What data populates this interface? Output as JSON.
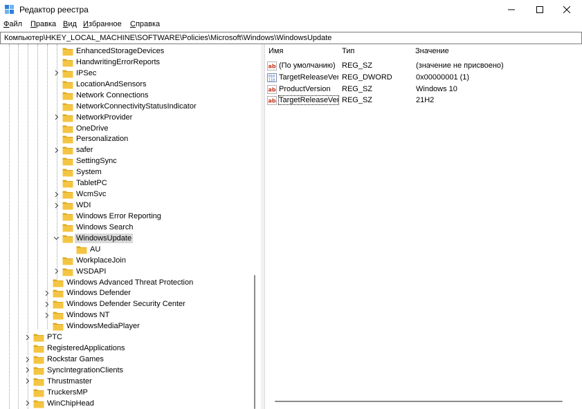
{
  "window": {
    "title": "Редактор реестра",
    "controls": {
      "minimize": "minimize",
      "maximize": "maximize",
      "close": "close"
    }
  },
  "menu": [
    {
      "first": "Ф",
      "rest": "айл"
    },
    {
      "first": "П",
      "rest": "равка"
    },
    {
      "first": "В",
      "rest": "ид"
    },
    {
      "first": "И",
      "rest": "збранное"
    },
    {
      "first": "С",
      "rest": "правка"
    }
  ],
  "address": "Компьютер\\HKEY_LOCAL_MACHINE\\SOFTWARE\\Policies\\Microsoft\\Windows\\WindowsUpdate",
  "tree": [
    {
      "label": "EnhancedStorageDevices",
      "expander": "none",
      "level": 3
    },
    {
      "label": "HandwritingErrorReports",
      "expander": "none",
      "level": 3
    },
    {
      "label": "IPSec",
      "expander": "collapsed",
      "level": 3
    },
    {
      "label": "LocationAndSensors",
      "expander": "none",
      "level": 3
    },
    {
      "label": "Network Connections",
      "expander": "none",
      "level": 3
    },
    {
      "label": "NetworkConnectivityStatusIndicator",
      "expander": "none",
      "level": 3
    },
    {
      "label": "NetworkProvider",
      "expander": "collapsed",
      "level": 3
    },
    {
      "label": "OneDrive",
      "expander": "none",
      "level": 3
    },
    {
      "label": "Personalization",
      "expander": "none",
      "level": 3
    },
    {
      "label": "safer",
      "expander": "collapsed",
      "level": 3
    },
    {
      "label": "SettingSync",
      "expander": "none",
      "level": 3
    },
    {
      "label": "System",
      "expander": "none",
      "level": 3
    },
    {
      "label": "TabletPC",
      "expander": "none",
      "level": 3
    },
    {
      "label": "WcmSvc",
      "expander": "collapsed",
      "level": 3
    },
    {
      "label": "WDI",
      "expander": "collapsed",
      "level": 3
    },
    {
      "label": "Windows Error Reporting",
      "expander": "none",
      "level": 3
    },
    {
      "label": "Windows Search",
      "expander": "none",
      "level": 3
    },
    {
      "label": "WindowsUpdate",
      "expander": "expanded",
      "level": 3,
      "selected": true
    },
    {
      "label": "AU",
      "expander": "none",
      "level": 4
    },
    {
      "label": "WorkplaceJoin",
      "expander": "none",
      "level": 3
    },
    {
      "label": "WSDAPI",
      "expander": "collapsed",
      "level": 3
    },
    {
      "label": "Windows Advanced Threat Protection",
      "expander": "none",
      "level": 2
    },
    {
      "label": "Windows Defender",
      "expander": "collapsed",
      "level": 2
    },
    {
      "label": "Windows Defender Security Center",
      "expander": "collapsed",
      "level": 2
    },
    {
      "label": "Windows NT",
      "expander": "collapsed",
      "level": 2
    },
    {
      "label": "WindowsMediaPlayer",
      "expander": "none",
      "level": 2
    },
    {
      "label": "PTC",
      "expander": "collapsed",
      "level": 1
    },
    {
      "label": "RegisteredApplications",
      "expander": "none",
      "level": 1
    },
    {
      "label": "Rockstar Games",
      "expander": "collapsed",
      "level": 1
    },
    {
      "label": "SyncIntegrationClients",
      "expander": "collapsed",
      "level": 1
    },
    {
      "label": "Thrustmaster",
      "expander": "collapsed",
      "level": 1
    },
    {
      "label": "TruckersMP",
      "expander": "none",
      "level": 1
    },
    {
      "label": "WinChipHead",
      "expander": "collapsed",
      "level": 1
    }
  ],
  "columns": {
    "name": "Имя",
    "type": "Тип",
    "data": "Значение"
  },
  "values": [
    {
      "icon": "string-value-icon",
      "name": "(По умолчанию)",
      "type": "REG_SZ",
      "data": "(значение не присвоено)"
    },
    {
      "icon": "dword-value-icon",
      "name": "TargetReleaseVer...",
      "type": "REG_DWORD",
      "data": "0x00000001 (1)"
    },
    {
      "icon": "string-value-icon",
      "name": "ProductVersion",
      "type": "REG_SZ",
      "data": "Windows 10"
    },
    {
      "icon": "string-value-icon",
      "name": "TargetReleaseVer...",
      "type": "REG_SZ",
      "data": "21H2",
      "focused": true
    }
  ],
  "colors": {
    "folder": "#f4c542",
    "folder_dark": "#dcaa22",
    "selection": "#d9d9d9",
    "string_icon": "#c4341f",
    "dword_icon": "#2b5fb4"
  }
}
